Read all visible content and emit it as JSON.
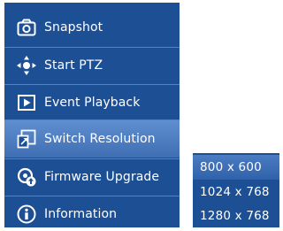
{
  "menu": {
    "items": [
      {
        "label": "Snapshot",
        "icon": "camera-icon"
      },
      {
        "label": "Start PTZ",
        "icon": "ptz-move-icon"
      },
      {
        "label": "Event Playback",
        "icon": "play-icon"
      },
      {
        "label": "Switch Resolution",
        "icon": "switch-resolution-icon",
        "active": true
      },
      {
        "label": "Firmware Upgrade",
        "icon": "firmware-upgrade-icon"
      },
      {
        "label": "Information",
        "icon": "info-icon"
      }
    ]
  },
  "resolution_submenu": {
    "options": [
      {
        "label": "800 x 600",
        "active": true
      },
      {
        "label": "1024 x 768"
      },
      {
        "label": "1280 x 768"
      }
    ]
  },
  "colors": {
    "menu_bg": "#1d4f95",
    "highlight": "#4f7fc3",
    "text": "#ffffff"
  }
}
